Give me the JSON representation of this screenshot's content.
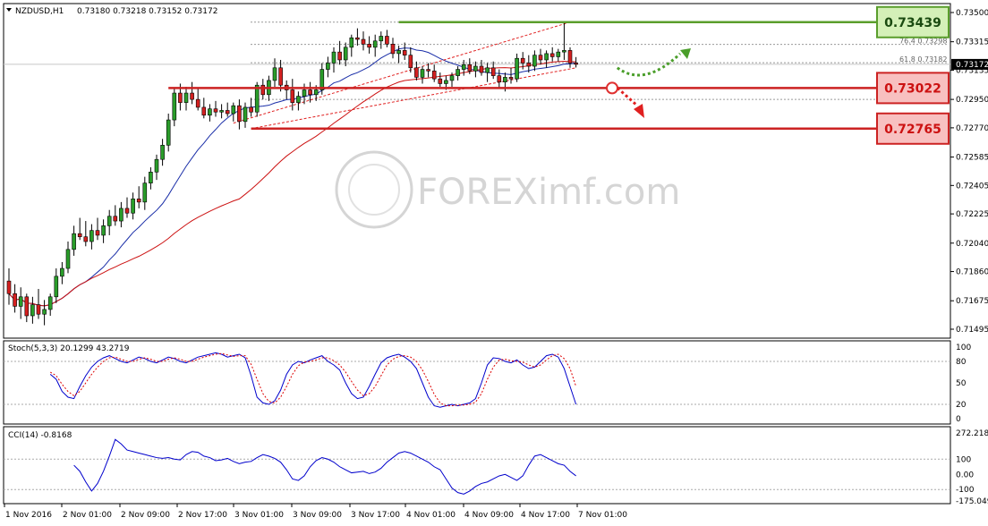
{
  "header": {
    "symbol": "NZDUSD,H1",
    "ohlc": "0.73180 0.73218 0.73152 0.73172"
  },
  "chart_data": [
    {
      "type": "candlestick",
      "symbol": "NZDUSD",
      "timeframe": "H1",
      "ylim": [
        0.71495,
        0.735
      ],
      "yticks": [
        "0.73500",
        "0.73315",
        "0.73135",
        "0.72950",
        "0.72770",
        "0.72585",
        "0.72405",
        "0.72225",
        "0.72040",
        "0.71860",
        "0.71675",
        "0.71495"
      ],
      "current_price": "0.73172",
      "xticks": [
        "1 Nov 2016",
        "2 Nov 01:00",
        "2 Nov 09:00",
        "2 Nov 17:00",
        "3 Nov 01:00",
        "3 Nov 09:00",
        "3 Nov 17:00",
        "4 Nov 01:00",
        "4 Nov 09:00",
        "4 Nov 17:00",
        "7 Nov 01:00"
      ],
      "candles": [
        [
          0.718,
          0.7188,
          0.7165,
          0.7172
        ],
        [
          0.7172,
          0.7178,
          0.716,
          0.7164
        ],
        [
          0.7164,
          0.7176,
          0.7156,
          0.717
        ],
        [
          0.717,
          0.7172,
          0.7154,
          0.7158
        ],
        [
          0.7158,
          0.717,
          0.7153,
          0.7165
        ],
        [
          0.7165,
          0.7175,
          0.7156,
          0.7159
        ],
        [
          0.7159,
          0.7168,
          0.7152,
          0.7162
        ],
        [
          0.7162,
          0.7172,
          0.7158,
          0.717
        ],
        [
          0.717,
          0.7188,
          0.7166,
          0.7183
        ],
        [
          0.7183,
          0.7192,
          0.7178,
          0.7188
        ],
        [
          0.7188,
          0.7205,
          0.7185,
          0.72
        ],
        [
          0.72,
          0.7215,
          0.7196,
          0.721
        ],
        [
          0.721,
          0.722,
          0.7206,
          0.7208
        ],
        [
          0.7208,
          0.7218,
          0.7202,
          0.7205
        ],
        [
          0.7205,
          0.7216,
          0.72,
          0.7212
        ],
        [
          0.7212,
          0.722,
          0.7206,
          0.7209
        ],
        [
          0.7209,
          0.7219,
          0.7204,
          0.7215
        ],
        [
          0.7215,
          0.7225,
          0.7209,
          0.7221
        ],
        [
          0.7221,
          0.7228,
          0.7215,
          0.7218
        ],
        [
          0.7218,
          0.723,
          0.7214,
          0.7226
        ],
        [
          0.7226,
          0.7233,
          0.722,
          0.7223
        ],
        [
          0.7223,
          0.7236,
          0.7219,
          0.7232
        ],
        [
          0.7232,
          0.724,
          0.7226,
          0.723
        ],
        [
          0.723,
          0.7246,
          0.7225,
          0.7242
        ],
        [
          0.7242,
          0.7252,
          0.7238,
          0.7249
        ],
        [
          0.7249,
          0.726,
          0.7244,
          0.7257
        ],
        [
          0.7257,
          0.727,
          0.7253,
          0.7266
        ],
        [
          0.7266,
          0.7286,
          0.7262,
          0.7282
        ],
        [
          0.7282,
          0.7302,
          0.7278,
          0.7299
        ],
        [
          0.7299,
          0.7305,
          0.7288,
          0.7293
        ],
        [
          0.7293,
          0.7303,
          0.7288,
          0.7299
        ],
        [
          0.7299,
          0.7306,
          0.7292,
          0.7295
        ],
        [
          0.7295,
          0.7302,
          0.7288,
          0.729
        ],
        [
          0.729,
          0.7296,
          0.7283,
          0.7285
        ],
        [
          0.7285,
          0.7292,
          0.7281,
          0.7289
        ],
        [
          0.7289,
          0.7294,
          0.7284,
          0.7287
        ],
        [
          0.7287,
          0.7292,
          0.7283,
          0.7288
        ],
        [
          0.7288,
          0.7293,
          0.7284,
          0.7286
        ],
        [
          0.7286,
          0.7293,
          0.7281,
          0.7291
        ],
        [
          0.7291,
          0.7295,
          0.7276,
          0.7281
        ],
        [
          0.7281,
          0.7293,
          0.7277,
          0.729
        ],
        [
          0.729,
          0.7296,
          0.7284,
          0.7287
        ],
        [
          0.7287,
          0.7306,
          0.7284,
          0.7304
        ],
        [
          0.7304,
          0.7308,
          0.7295,
          0.7298
        ],
        [
          0.7298,
          0.731,
          0.7294,
          0.7307
        ],
        [
          0.7307,
          0.7321,
          0.7303,
          0.7315
        ],
        [
          0.7315,
          0.732,
          0.73,
          0.7304
        ],
        [
          0.7304,
          0.7307,
          0.7295,
          0.7301
        ],
        [
          0.7301,
          0.7308,
          0.7288,
          0.7293
        ],
        [
          0.7293,
          0.73,
          0.7288,
          0.7297
        ],
        [
          0.7297,
          0.7305,
          0.7292,
          0.7301
        ],
        [
          0.7301,
          0.7306,
          0.7293,
          0.7298
        ],
        [
          0.7298,
          0.7304,
          0.7294,
          0.7301
        ],
        [
          0.7301,
          0.7318,
          0.7298,
          0.7314
        ],
        [
          0.7314,
          0.7322,
          0.7309,
          0.7318
        ],
        [
          0.7318,
          0.7328,
          0.7312,
          0.7325
        ],
        [
          0.7325,
          0.7332,
          0.7317,
          0.732
        ],
        [
          0.732,
          0.7331,
          0.7316,
          0.7328
        ],
        [
          0.7328,
          0.7336,
          0.7322,
          0.7334
        ],
        [
          0.7334,
          0.734,
          0.7329,
          0.7333
        ],
        [
          0.7333,
          0.7338,
          0.7326,
          0.733
        ],
        [
          0.733,
          0.7335,
          0.7324,
          0.7328
        ],
        [
          0.7328,
          0.7336,
          0.7322,
          0.7332
        ],
        [
          0.7332,
          0.7338,
          0.7327,
          0.7335
        ],
        [
          0.7335,
          0.7339,
          0.7328,
          0.733
        ],
        [
          0.733,
          0.7334,
          0.7321,
          0.7324
        ],
        [
          0.7324,
          0.7329,
          0.7318,
          0.7326
        ],
        [
          0.7326,
          0.7331,
          0.732,
          0.7323
        ],
        [
          0.7323,
          0.7328,
          0.7312,
          0.7315
        ],
        [
          0.7315,
          0.7319,
          0.7307,
          0.7309
        ],
        [
          0.7309,
          0.7316,
          0.7305,
          0.7314
        ],
        [
          0.7314,
          0.7318,
          0.7309,
          0.7313
        ],
        [
          0.7313,
          0.7317,
          0.7306,
          0.7308
        ],
        [
          0.7308,
          0.7312,
          0.7303,
          0.7305
        ],
        [
          0.7305,
          0.731,
          0.7301,
          0.7307
        ],
        [
          0.7307,
          0.7312,
          0.7303,
          0.731
        ],
        [
          0.731,
          0.7316,
          0.7307,
          0.7314
        ],
        [
          0.7314,
          0.732,
          0.731,
          0.7317
        ],
        [
          0.7317,
          0.7321,
          0.7311,
          0.7313
        ],
        [
          0.7313,
          0.7319,
          0.7309,
          0.7316
        ],
        [
          0.7316,
          0.732,
          0.731,
          0.7312
        ],
        [
          0.7312,
          0.7318,
          0.7306,
          0.7315
        ],
        [
          0.7315,
          0.7319,
          0.7308,
          0.731
        ],
        [
          0.731,
          0.7314,
          0.7302,
          0.7306
        ],
        [
          0.7306,
          0.7312,
          0.73,
          0.7309
        ],
        [
          0.7309,
          0.7315,
          0.7305,
          0.7308
        ],
        [
          0.7308,
          0.7324,
          0.7306,
          0.7321
        ],
        [
          0.7321,
          0.7325,
          0.7314,
          0.7318
        ],
        [
          0.7318,
          0.7323,
          0.7312,
          0.7316
        ],
        [
          0.7316,
          0.7326,
          0.7313,
          0.7323
        ],
        [
          0.7323,
          0.7327,
          0.7317,
          0.732
        ],
        [
          0.732,
          0.7326,
          0.7315,
          0.7324
        ],
        [
          0.7324,
          0.7328,
          0.7319,
          0.7322
        ],
        [
          0.7322,
          0.7327,
          0.7319,
          0.7325
        ],
        [
          0.7325,
          0.73439,
          0.732,
          0.7326
        ],
        [
          0.7326,
          0.7328,
          0.7315,
          0.7318
        ],
        [
          0.7318,
          0.73218,
          0.73152,
          0.73172
        ]
      ],
      "fib_labels": [
        "76.4 0.73298",
        "61.8 0.73182"
      ],
      "levels": [
        {
          "label": "0.73439",
          "kind": "resistance",
          "color": "#5a9e2c"
        },
        {
          "label": "0.73022",
          "kind": "support",
          "color": "#cc2222"
        },
        {
          "label": "0.72765",
          "kind": "support",
          "color": "#cc2222"
        }
      ],
      "watermark": "FOREXimf.com"
    },
    {
      "type": "line",
      "title": "Stoch(5,3,3) 20.1299 43.2719",
      "ylim": [
        0,
        100
      ],
      "yticks": [
        "100",
        "80",
        "50",
        "20",
        "0"
      ],
      "series": [
        {
          "color": "#0000cc",
          "values": [
            62,
            55,
            38,
            30,
            28,
            45,
            60,
            72,
            80,
            85,
            88,
            84,
            80,
            78,
            82,
            86,
            84,
            80,
            78,
            82,
            86,
            84,
            80,
            78,
            82,
            86,
            88,
            90,
            92,
            90,
            86,
            88,
            90,
            85,
            60,
            30,
            22,
            20,
            25,
            40,
            62,
            75,
            80,
            78,
            82,
            85,
            88,
            80,
            75,
            68,
            50,
            35,
            28,
            30,
            45,
            62,
            78,
            85,
            88,
            90,
            86,
            80,
            70,
            50,
            30,
            18,
            16,
            18,
            20,
            18,
            20,
            22,
            28,
            50,
            75,
            85,
            84,
            80,
            78,
            82,
            75,
            70,
            72,
            80,
            88,
            90,
            86,
            70,
            45,
            20
          ]
        },
        {
          "color": "#dd0000",
          "values": [
            65,
            60,
            48,
            38,
            32,
            38,
            50,
            62,
            72,
            80,
            85,
            86,
            83,
            80,
            80,
            83,
            85,
            83,
            80,
            80,
            83,
            85,
            83,
            80,
            80,
            83,
            86,
            88,
            90,
            91,
            89,
            87,
            88,
            88,
            76,
            55,
            35,
            24,
            22,
            30,
            45,
            62,
            74,
            79,
            80,
            82,
            85,
            85,
            81,
            75,
            65,
            52,
            40,
            32,
            35,
            45,
            60,
            75,
            83,
            87,
            88,
            86,
            80,
            68,
            52,
            34,
            22,
            18,
            18,
            19,
            19,
            20,
            23,
            35,
            55,
            72,
            82,
            83,
            81,
            80,
            79,
            75,
            72,
            75,
            82,
            88,
            90,
            84,
            70,
            45
          ]
        }
      ]
    },
    {
      "type": "line",
      "title": "CCI(14) -0.8168",
      "ylim": [
        -175.049,
        272.2185
      ],
      "yticks": [
        "272.2185",
        "100",
        "0.00",
        "-100",
        "-175.049"
      ],
      "series": [
        {
          "color": "#0000cc",
          "values": [
            60,
            20,
            -50,
            -110,
            -60,
            20,
            120,
            230,
            200,
            160,
            150,
            140,
            130,
            120,
            110,
            105,
            110,
            100,
            95,
            130,
            150,
            145,
            120,
            110,
            90,
            95,
            105,
            85,
            70,
            80,
            85,
            110,
            130,
            120,
            105,
            80,
            30,
            -30,
            -40,
            -10,
            50,
            90,
            110,
            100,
            80,
            50,
            30,
            10,
            15,
            20,
            5,
            15,
            40,
            80,
            110,
            140,
            150,
            140,
            120,
            100,
            80,
            50,
            30,
            -30,
            -90,
            -120,
            -130,
            -110,
            -80,
            -60,
            -50,
            -30,
            -10,
            0,
            -20,
            -40,
            -10,
            60,
            120,
            130,
            110,
            90,
            70,
            60,
            20,
            -10
          ]
        }
      ]
    }
  ]
}
